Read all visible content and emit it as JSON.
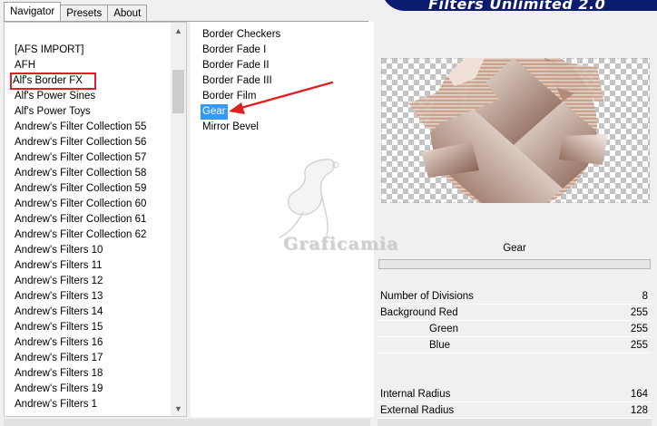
{
  "banner": {
    "title": "Filters Unlimited 2.0"
  },
  "tabs": [
    {
      "label": "Navigator",
      "active": true
    },
    {
      "label": "Presets",
      "active": false
    },
    {
      "label": "About",
      "active": false
    }
  ],
  "categories": {
    "highlighted_index": 2,
    "items": [
      "[AFS IMPORT]",
      "AFH",
      "Alf's Border FX",
      "Alf's Power Sines",
      "Alf's Power Toys",
      "Andrew's Filter Collection 55",
      "Andrew's Filter Collection 56",
      "Andrew's Filter Collection 57",
      "Andrew's Filter Collection 58",
      "Andrew's Filter Collection 59",
      "Andrew's Filter Collection 60",
      "Andrew's Filter Collection 61",
      "Andrew's Filter Collection 62",
      "Andrew's Filters 10",
      "Andrew's Filters 11",
      "Andrew's Filters 12",
      "Andrew's Filters 13",
      "Andrew's Filters 14",
      "Andrew's Filters 15",
      "Andrew's Filters 16",
      "Andrew's Filters 17",
      "Andrew's Filters 18",
      "Andrew's Filters 19",
      "Andrew's Filters 1"
    ]
  },
  "filters": {
    "selected_index": 5,
    "items": [
      "Border Checkers",
      "Border Fade I",
      "Border Fade II",
      "Border Fade III",
      "Border Film",
      "Gear",
      "Mirror Bevel"
    ]
  },
  "watermark": {
    "text": "Graficamia"
  },
  "filter_name": "Gear",
  "params": [
    {
      "label": "Number of Divisions",
      "value": "8",
      "indent": false
    },
    {
      "label": "Background Red",
      "value": "255",
      "indent": false
    },
    {
      "label": "Green",
      "value": "255",
      "indent": true
    },
    {
      "label": "Blue",
      "value": "255",
      "indent": true
    }
  ],
  "params2": [
    {
      "label": "Internal Radius",
      "value": "164",
      "indent": false
    },
    {
      "label": "External Radius",
      "value": "128",
      "indent": false
    }
  ],
  "colors": {
    "selection": "#3399ff",
    "annotation": "#e02020",
    "banner": "#0b1b6e"
  }
}
